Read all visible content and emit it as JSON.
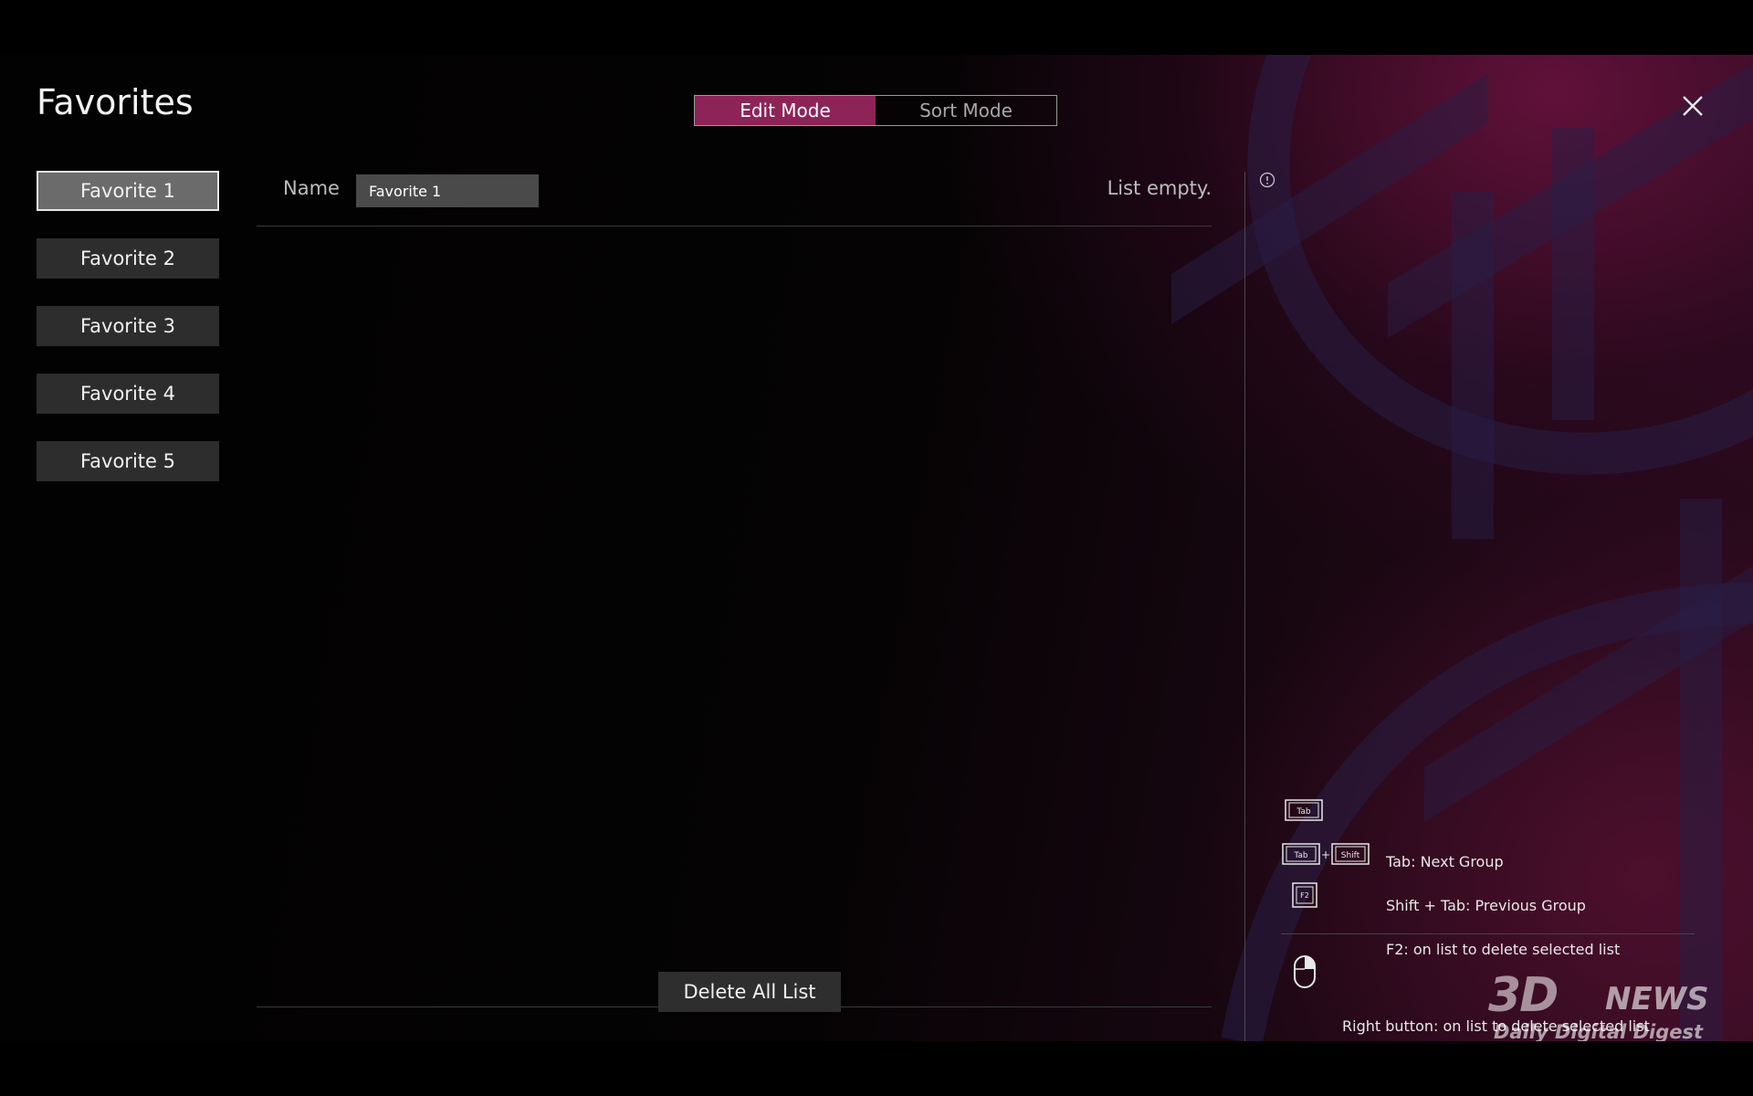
{
  "header": {
    "title": "Favorites",
    "modes": [
      {
        "label": "Edit Mode",
        "active": true
      },
      {
        "label": "Sort Mode",
        "active": false
      }
    ]
  },
  "sidebar": {
    "items": [
      {
        "label": "Favorite 1",
        "selected": true
      },
      {
        "label": "Favorite 2",
        "selected": false
      },
      {
        "label": "Favorite 3",
        "selected": false
      },
      {
        "label": "Favorite 4",
        "selected": false
      },
      {
        "label": "Favorite 5",
        "selected": false
      }
    ]
  },
  "main": {
    "name_label": "Name",
    "name_value": "Favorite 1",
    "list_status": "List empty.",
    "delete_all_label": "Delete All List"
  },
  "hints": {
    "items": [
      {
        "icon": "tab-key-icon",
        "key_labels": [
          "Tab"
        ],
        "text": "Tab: Next Group"
      },
      {
        "icon": "shift-tab-keys-icon",
        "key_labels": [
          "Tab",
          "Shift"
        ],
        "text": "Shift + Tab: Previous Group"
      },
      {
        "icon": "f2-key-icon",
        "key_labels": [
          "F2"
        ],
        "text": "F2: on list to delete selected list"
      },
      {
        "icon": "mouse-right-button-icon",
        "text": "Right button: on list to delete selected list"
      }
    ]
  },
  "watermark": {
    "logo": "3D",
    "news": "NEWS",
    "tagline": "Daily Digital Digest"
  },
  "colors": {
    "accent": "#8e2357",
    "button_bg": "#2d2d2d",
    "selected_bg": "#6b6b6b"
  }
}
